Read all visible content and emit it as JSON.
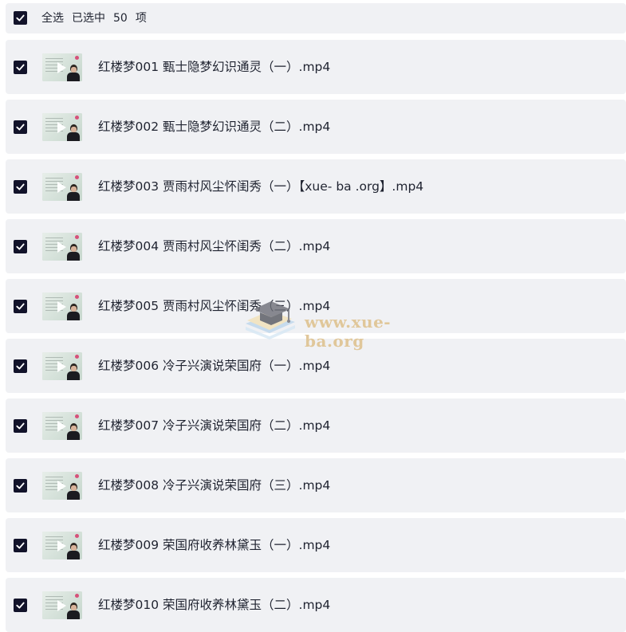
{
  "header": {
    "select_all": "全选",
    "selected_prefix": "已选中",
    "count": "50",
    "unit": "项"
  },
  "files": [
    {
      "name": "红楼梦001 甄士隐梦幻识通灵（一）.mp4",
      "checked": true
    },
    {
      "name": "红楼梦002 甄士隐梦幻识通灵（二）.mp4",
      "checked": true
    },
    {
      "name": "红楼梦003 贾雨村风尘怀闺秀（一）【xue- ba .org】.mp4",
      "checked": true
    },
    {
      "name": "红楼梦004 贾雨村风尘怀闺秀（二）.mp4",
      "checked": true
    },
    {
      "name": "红楼梦005 贾雨村风尘怀闺秀（三）.mp4",
      "checked": true
    },
    {
      "name": "红楼梦006 冷子兴演说荣国府（一）.mp4",
      "checked": true
    },
    {
      "name": "红楼梦007 冷子兴演说荣国府（二）.mp4",
      "checked": true
    },
    {
      "name": "红楼梦008 冷子兴演说荣国府（三）.mp4",
      "checked": true
    },
    {
      "name": "红楼梦009 荣国府收养林黛玉（一）.mp4",
      "checked": true
    },
    {
      "name": "红楼梦010 荣国府收养林黛玉（二）.mp4",
      "checked": true
    }
  ],
  "watermark": {
    "text": "www.xue-ba.org"
  },
  "colors": {
    "checkbox": "#12132a",
    "row_bg": "#f0f1f4",
    "watermark_text": "#e0c596"
  }
}
